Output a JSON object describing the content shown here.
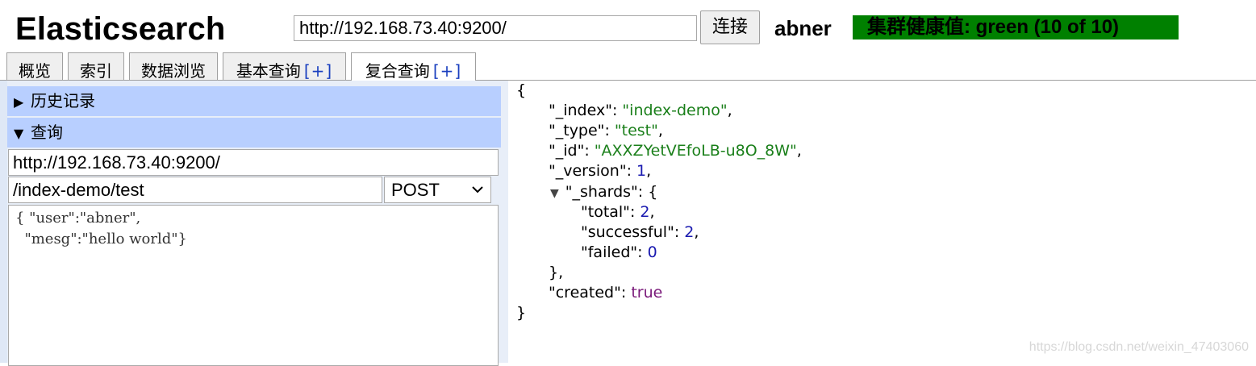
{
  "header": {
    "title": "Elasticsearch",
    "connect_url": "http://192.168.73.40:9200/",
    "connect_label": "连接",
    "cluster_name": "abner",
    "health": "集群健康值: green (10 of 10)",
    "health_color": "#008000"
  },
  "tabs": [
    {
      "label": "概览",
      "plus": ""
    },
    {
      "label": "索引",
      "plus": ""
    },
    {
      "label": "数据浏览",
      "plus": ""
    },
    {
      "label": "基本查询",
      "plus": "[+]"
    },
    {
      "label": "复合查询",
      "plus": "[+]",
      "active": true
    }
  ],
  "left": {
    "history_header": "历史记录",
    "query_header": "查询",
    "server_url": "http://192.168.73.40:9200/",
    "path": "/index-demo/test",
    "method": "POST",
    "method_options": [
      "POST"
    ],
    "body_line1": "{ \"user\":\"abner\",",
    "body_line2": "  \"mesg\":\"hello world\"}"
  },
  "response": {
    "open_brace": "{",
    "close_brace": "}",
    "index_key": "\"_index\"",
    "index_val": "\"index-demo\"",
    "type_key": "\"_type\"",
    "type_val": "\"test\"",
    "id_key": "\"_id\"",
    "id_val": "\"AXXZYetVEfoLB-u8O_8W\"",
    "version_key": "\"_version\"",
    "version_val": "1",
    "shards_toggle": "▼",
    "shards_key": "\"_shards\"",
    "total_key": "\"total\"",
    "total_val": "2",
    "successful_key": "\"successful\"",
    "successful_val": "2",
    "failed_key": "\"failed\"",
    "failed_val": "0",
    "shards_close": "},",
    "created_key": "\"created\"",
    "created_val": "true"
  },
  "watermark": "https://blog.csdn.net/weixin_47403060"
}
